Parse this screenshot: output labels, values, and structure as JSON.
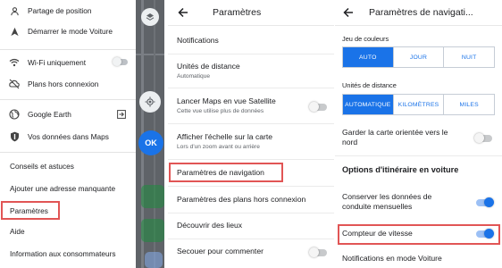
{
  "drawer": {
    "items": [
      {
        "label": "Partage de position",
        "icon": "person-pin-icon"
      },
      {
        "label": "Démarrer le mode Voiture",
        "icon": "car-mode-icon"
      },
      {
        "label": "Wi-Fi uniquement",
        "icon": "wifi-icon"
      },
      {
        "label": "Plans hors connexion",
        "icon": "offline-maps-icon"
      },
      {
        "label": "Google Earth",
        "icon": "earth-icon"
      },
      {
        "label": "Vos données dans Maps",
        "icon": "shield-icon"
      },
      {
        "label": "Conseils et astuces"
      },
      {
        "label": "Ajouter une adresse manquante"
      },
      {
        "label": "Paramètres"
      },
      {
        "label": "Aide"
      },
      {
        "label": "Information aux consommateurs"
      }
    ],
    "map_ok_label": "OK",
    "wifi_toggle_on": false
  },
  "settings": {
    "title": "Paramètres",
    "items": [
      {
        "label": "Notifications",
        "sub": ""
      },
      {
        "label": "Unités de distance",
        "sub": "Automatique"
      },
      {
        "label": "Lancer Maps en vue Satellite",
        "sub": "Cette vue utilise plus de données"
      },
      {
        "label": "Afficher l'échelle sur la carte",
        "sub": "Lors d'un zoom avant ou arrière"
      },
      {
        "label": "Paramètres de navigation",
        "sub": ""
      },
      {
        "label": "Paramètres des plans hors connexion",
        "sub": ""
      },
      {
        "label": "Découvrir des lieux",
        "sub": ""
      },
      {
        "label": "Secouer pour commenter",
        "sub": ""
      }
    ]
  },
  "nav_settings": {
    "title": "Paramètres de navigati...",
    "color_scheme_label": "Jeu de couleurs",
    "color_scheme_options": [
      "AUTO",
      "JOUR",
      "NUIT"
    ],
    "color_scheme_selected": "AUTO",
    "distance_label": "Unités de distance",
    "distance_options": [
      "AUTOMATIQUE",
      "KILOMÈTRES",
      "MILES"
    ],
    "distance_selected": "AUTOMATIQUE",
    "north_label_1": "Garder la carte orientée vers le",
    "north_label_2": "nord",
    "route_options_header": "Options d'itinéraire en voiture",
    "monthly_label_1": "Conserver les données de",
    "monthly_label_2": "conduite mensuelles",
    "speedometer_label": "Compteur de vitesse",
    "notif_label": "Notifications en mode Voiture"
  },
  "colors": {
    "accent": "#1a73e8",
    "highlight": "#e15555"
  }
}
